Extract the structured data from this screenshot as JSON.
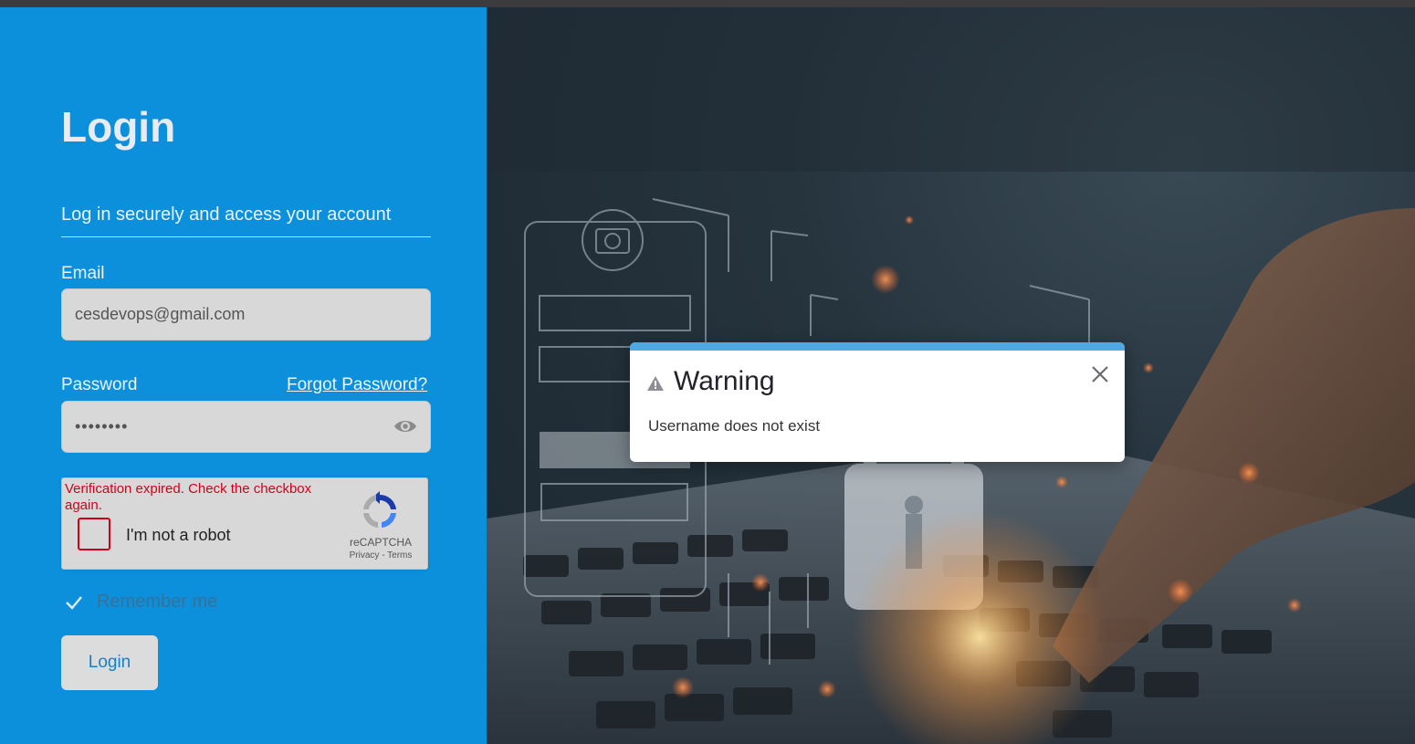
{
  "login": {
    "title": "Login",
    "subtitle": "Log in securely and access your account",
    "email_label": "Email",
    "email_value": "cesdevops@gmail.com",
    "password_label": "Password",
    "forgot_password": "Forgot Password?",
    "password_value": "••••••••",
    "remember_label": "Remember me",
    "login_button": "Login"
  },
  "captcha": {
    "error": "Verification expired. Check the checkbox again.",
    "label": "I'm not a robot",
    "brand": "reCAPTCHA",
    "links": "Privacy - Terms"
  },
  "modal": {
    "title": "Warning",
    "message": "Username does not exist"
  },
  "colors": {
    "panel": "#0d90dc",
    "modal_accent": "#4ea9e3",
    "error": "#d0021b"
  },
  "icons": [
    "eye-icon",
    "recaptcha-icon",
    "check-icon",
    "warning-icon",
    "close-icon"
  ]
}
